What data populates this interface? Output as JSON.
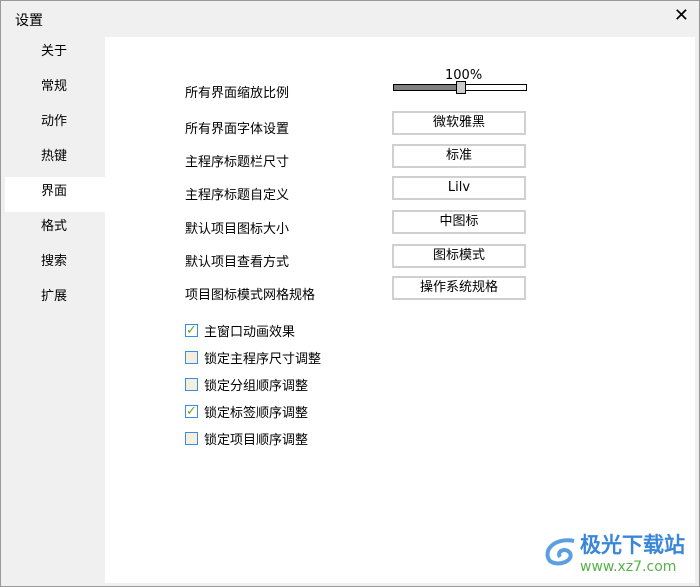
{
  "window": {
    "title": "设置",
    "close": "✕"
  },
  "sidebar": {
    "items": [
      {
        "label": "关于"
      },
      {
        "label": "常规"
      },
      {
        "label": "动作"
      },
      {
        "label": "热键"
      },
      {
        "label": "界面",
        "active": true
      },
      {
        "label": "格式"
      },
      {
        "label": "搜索"
      },
      {
        "label": "扩展"
      }
    ]
  },
  "settings": {
    "scale": {
      "label": "所有界面缩放比例",
      "value_text": "100%",
      "fraction": 0.5
    },
    "rows": [
      {
        "label": "所有界面字体设置",
        "value": "微软雅黑"
      },
      {
        "label": "主程序标题栏尺寸",
        "value": "标准"
      },
      {
        "label": "主程序标题自定义",
        "value": "Lilv"
      },
      {
        "label": "默认项目图标大小",
        "value": "中图标"
      },
      {
        "label": "默认项目查看方式",
        "value": "图标模式"
      },
      {
        "label": "项目图标模式网格规格",
        "value": "操作系统规格"
      }
    ],
    "checkboxes": [
      {
        "label": "主窗口动画效果",
        "checked": true
      },
      {
        "label": "锁定主程序尺寸调整",
        "checked": false
      },
      {
        "label": "锁定分组顺序调整",
        "checked": false
      },
      {
        "label": "锁定标签顺序调整",
        "checked": true
      },
      {
        "label": "锁定项目顺序调整",
        "checked": false
      }
    ]
  },
  "watermark": {
    "name": "极光下载站",
    "url": "www.xz7.com"
  }
}
